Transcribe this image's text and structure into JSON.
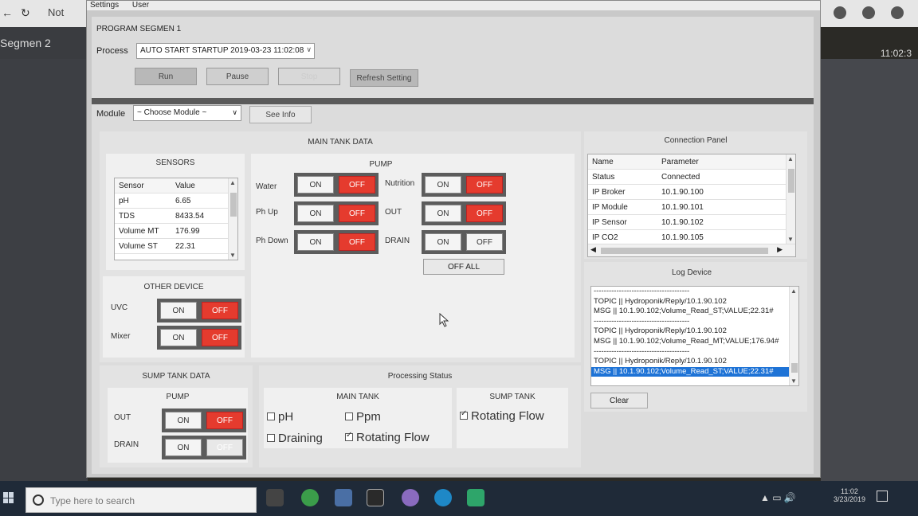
{
  "browser": {
    "not_label": "Not",
    "tab_label": "Segmen 2",
    "clock": "11:02:3"
  },
  "menu": {
    "settings": "Settings",
    "user": "User"
  },
  "program": {
    "title": "PROGRAM SEGMEN 1",
    "process_label": "Process",
    "process_value": "AUTO START STARTUP 2019-03-23 11:02:08",
    "run": "Run",
    "pause": "Pause",
    "stop": "Stop",
    "refresh": "Refresh Setting"
  },
  "module": {
    "label": "Module",
    "value": "~ Choose Module ~",
    "see_info": "See Info"
  },
  "main_tank": {
    "title": "MAIN TANK DATA",
    "sensors": {
      "title": "SENSORS",
      "headers": [
        "Sensor",
        "Value"
      ],
      "rows": [
        [
          "pH",
          "6.65"
        ],
        [
          "TDS",
          "8433.54"
        ],
        [
          "Volume MT",
          "176.99"
        ],
        [
          "Volume ST",
          "22.31"
        ]
      ]
    },
    "pump": {
      "title": "PUMP",
      "water": "Water",
      "ph_up": "Ph Up",
      "ph_down": "Ph Down",
      "nutrition": "Nutrition",
      "out": "OUT",
      "drain": "DRAIN",
      "on": "ON",
      "off": "OFF",
      "off_all": "OFF ALL"
    },
    "other_device": {
      "title": "OTHER DEVICE",
      "uvc": "UVC",
      "mixer": "Mixer"
    }
  },
  "sump_tank": {
    "title": "SUMP TANK DATA",
    "pump_title": "PUMP",
    "out": "OUT",
    "drain": "DRAIN"
  },
  "processing": {
    "title": "Processing Status",
    "main_tank": "MAIN TANK",
    "sump_tank": "SUMP TANK",
    "ph": "pH",
    "ppm": "Ppm",
    "draining": "Draining",
    "rotating_flow": "Rotating Flow"
  },
  "connection": {
    "title": "Connection Panel",
    "headers": [
      "Name",
      "Parameter"
    ],
    "rows": [
      [
        "Status",
        "Connected"
      ],
      [
        "IP Broker",
        "10.1.90.100"
      ],
      [
        "IP Module",
        "10.1.90.101"
      ],
      [
        "IP Sensor",
        "10.1.90.102"
      ],
      [
        "IP CO2",
        "10.1.90.105"
      ]
    ]
  },
  "log": {
    "title": "Log Device",
    "lines": [
      "--------------------------------------",
      "TOPIC || Hydroponik/Reply/10.1.90.102",
      "MSG || 10.1.90.102;Volume_Read_ST;VALUE;22.31#",
      "--------------------------------------",
      "TOPIC || Hydroponik/Reply/10.1.90.102",
      "MSG || 10.1.90.102;Volume_Read_MT;VALUE;176.94#",
      "--------------------------------------",
      "TOPIC || Hydroponik/Reply/10.1.90.102",
      "MSG || 10.1.90.102;Volume_Read_ST;VALUE;22.31#"
    ],
    "clear": "Clear"
  },
  "taskbar": {
    "search_placeholder": "Type here to search",
    "time": "11:02",
    "date": "3/23/2019"
  }
}
